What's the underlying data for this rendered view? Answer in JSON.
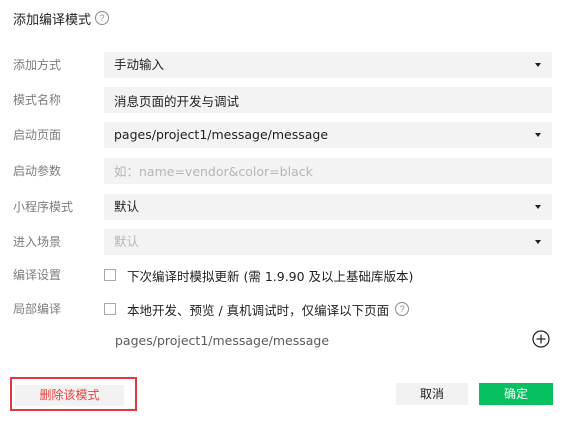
{
  "dialog": {
    "title": "添加编译模式",
    "title_help_icon": "question-circle-icon",
    "help_glyph": "?"
  },
  "form": {
    "add_method": {
      "label": "添加方式",
      "value": "手动输入"
    },
    "mode_name": {
      "label": "模式名称",
      "value": "消息页面的开发与调试"
    },
    "launch_page": {
      "label": "启动页面",
      "value": "pages/project1/message/message"
    },
    "launch_params": {
      "label": "启动参数",
      "value": "",
      "placeholder": "如：name=vendor&color=black"
    },
    "miniprogram_mode": {
      "label": "小程序模式",
      "value": "默认"
    },
    "entry_scene": {
      "label": "进入场景",
      "placeholder": "默认"
    },
    "compile_settings": {
      "label": "编译设置",
      "option_label": "下次编译时模拟更新 (需 1.9.90 及以上基础库版本)",
      "checked": false
    },
    "partial_compile": {
      "label": "局部编译",
      "option_label": "本地开发、预览 / 真机调试时，仅编译以下页面",
      "checked": false,
      "pages": [
        "pages/project1/message/message"
      ]
    }
  },
  "footer": {
    "delete_label": "删除该模式",
    "cancel_label": "取消",
    "ok_label": "确定"
  },
  "colors": {
    "primary": "#07c160",
    "danger_text": "#e64340",
    "highlight_border": "#e0393e",
    "field_bg": "#f3f3f3"
  },
  "icons": {
    "dropdown": "caret-down-icon",
    "add_page": "plus-circle-icon"
  }
}
